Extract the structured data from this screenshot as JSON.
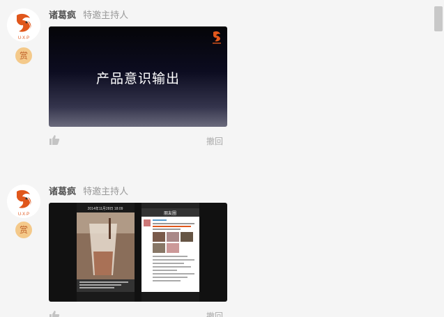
{
  "posts": [
    {
      "author": "诸葛疯",
      "role": "特邀主持人",
      "badge": "赏",
      "slide_title": "产品意识输出",
      "revoke_label": "撤回",
      "avatar_caption": "U·X·P"
    },
    {
      "author": "诸葛疯",
      "role": "特邀主持人",
      "badge": "赏",
      "revoke_label": "撤回",
      "avatar_caption": "U·X·P",
      "shot_left_time": "2014年11月28日 18:09",
      "shot_right_title": "朋友圈"
    }
  ],
  "colors": {
    "accent": "#e0571c",
    "badge_bg": "#f4c98a"
  }
}
